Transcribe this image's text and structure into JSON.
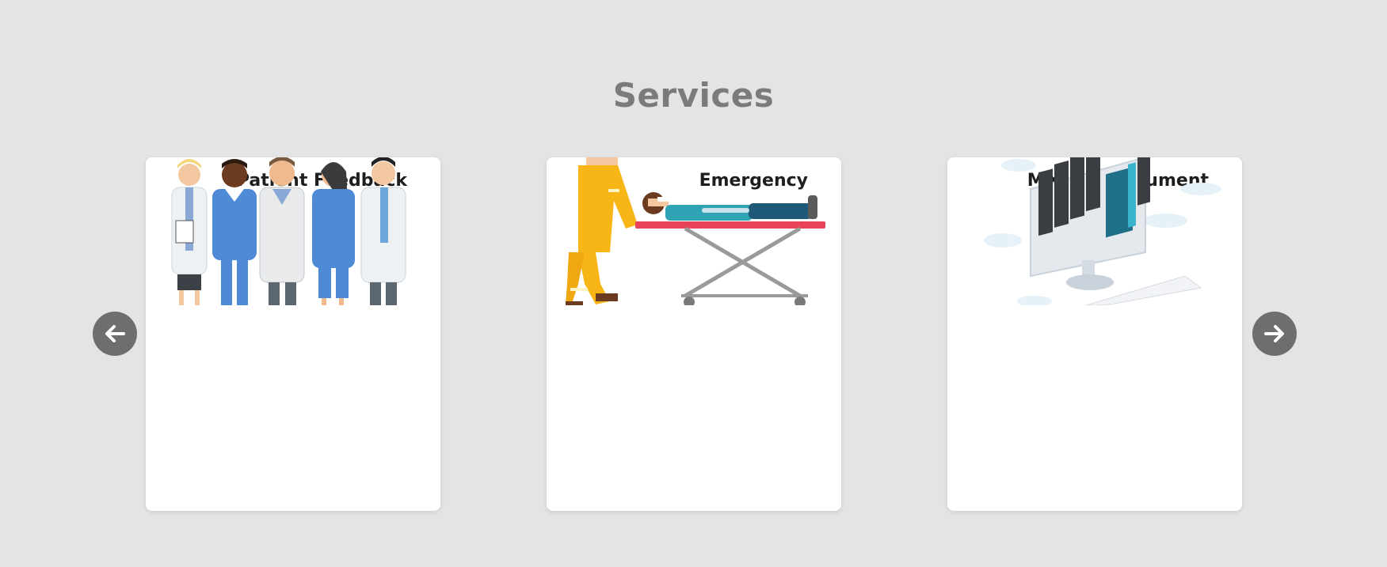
{
  "section": {
    "title": "Services"
  },
  "cards": [
    {
      "title": "Patient Feedback",
      "image_icon": "medical-staff-illustration"
    },
    {
      "title": "Emergency",
      "image_icon": "stretcher-illustration"
    },
    {
      "title": "Medical Document",
      "image_icon": "document-archive-illustration"
    }
  ],
  "nav": {
    "prev_icon": "arrow-left-icon",
    "next_icon": "arrow-right-icon"
  },
  "colors": {
    "background": "#e4e4e4",
    "title": "#7b7b7b",
    "card": "#ffffff",
    "nav_button": "#6e6e6e"
  }
}
